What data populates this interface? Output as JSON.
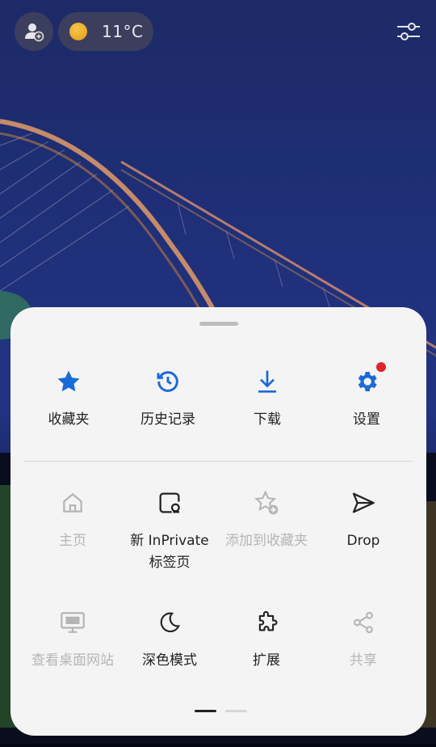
{
  "header": {
    "temperature": "11°C"
  },
  "menu": {
    "primary": [
      {
        "label": "收藏夹",
        "icon": "star-icon"
      },
      {
        "label": "历史记录",
        "icon": "history-icon"
      },
      {
        "label": "下载",
        "icon": "download-icon"
      },
      {
        "label": "设置",
        "icon": "gear-icon"
      }
    ],
    "secondary": [
      {
        "label": "主页",
        "icon": "home-icon",
        "disabled": true
      },
      {
        "label": "新 InPrivate",
        "label2": "标签页",
        "icon": "inprivate-tab-icon",
        "disabled": false
      },
      {
        "label": "添加到收藏夹",
        "icon": "add-favorite-icon",
        "disabled": true
      },
      {
        "label": "Drop",
        "icon": "send-icon",
        "disabled": false
      },
      {
        "label": "查看桌面网站",
        "icon": "desktop-icon",
        "disabled": true
      },
      {
        "label": "深色模式",
        "icon": "moon-icon",
        "disabled": false
      },
      {
        "label": "扩展",
        "icon": "puzzle-icon",
        "disabled": false
      },
      {
        "label": "共享",
        "icon": "share-icon",
        "disabled": true
      }
    ]
  },
  "colors": {
    "accent": "#1a6ad8",
    "notification": "#e0262b",
    "sheet_bg": "#f4f4f4",
    "disabled": "#b5b5b5"
  },
  "pager": {
    "pages": 2,
    "current": 1
  }
}
